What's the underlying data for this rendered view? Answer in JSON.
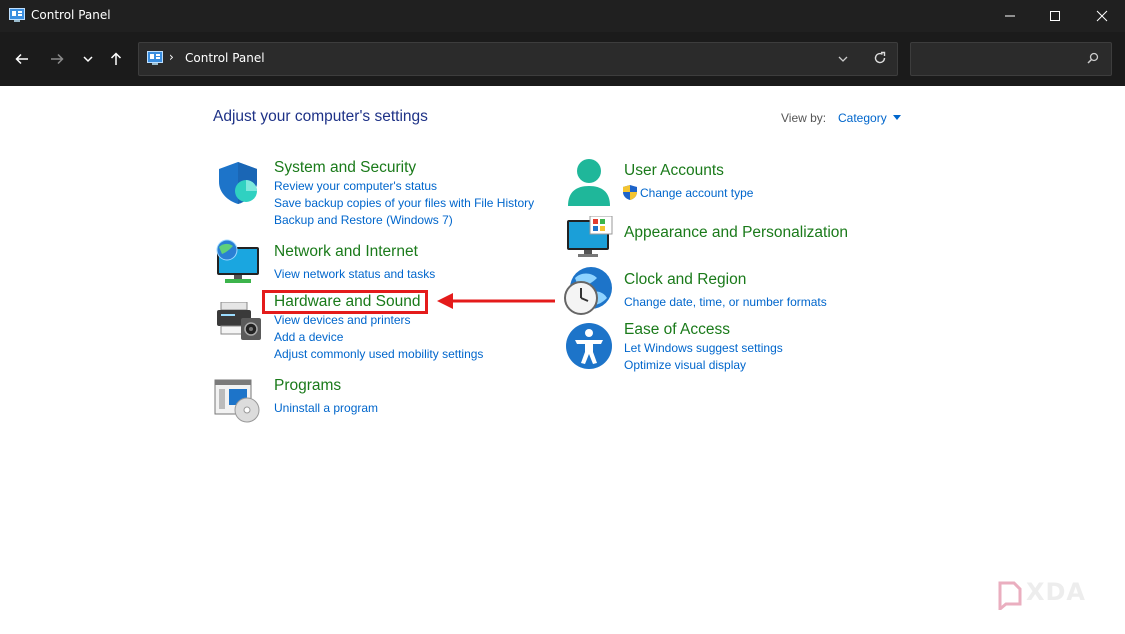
{
  "window": {
    "title": "Control Panel"
  },
  "address": {
    "path": "Control Panel",
    "separator": "›"
  },
  "search": {
    "placeholder": ""
  },
  "main": {
    "heading": "Adjust your computer's settings",
    "view_by_label": "View by:",
    "view_by_value": "Category"
  },
  "categories": {
    "system_security": {
      "title": "System and Security",
      "links": [
        "Review your computer's status",
        "Save backup copies of your files with File History",
        "Backup and Restore (Windows 7)"
      ]
    },
    "network_internet": {
      "title": "Network and Internet",
      "links": [
        "View network status and tasks"
      ]
    },
    "hardware_sound": {
      "title": "Hardware and Sound",
      "links": [
        "View devices and printers",
        "Add a device",
        "Adjust commonly used mobility settings"
      ]
    },
    "programs": {
      "title": "Programs",
      "links": [
        "Uninstall a program"
      ]
    },
    "user_accounts": {
      "title": "User Accounts",
      "links": [
        "Change account type"
      ]
    },
    "appearance": {
      "title": "Appearance and Personalization",
      "links": []
    },
    "clock_region": {
      "title": "Clock and Region",
      "links": [
        "Change date, time, or number formats"
      ]
    },
    "ease_access": {
      "title": "Ease of Access",
      "links": [
        "Let Windows suggest settings",
        "Optimize visual display"
      ]
    }
  },
  "watermark": {
    "text": "XDA"
  },
  "colors": {
    "title_bar": "#202020",
    "link": "#0066cc",
    "category": "#1a7a1a",
    "heading": "#1e3287",
    "annotation": "#e41b1b"
  },
  "icons": [
    "control-panel-icon",
    "back-icon",
    "forward-icon",
    "recent-icon",
    "up-icon",
    "refresh-icon",
    "search-icon",
    "minimize-icon",
    "maximize-icon",
    "close-icon",
    "shield-icon",
    "network-icon",
    "printer-icon",
    "programs-icon",
    "user-icon",
    "uac-shield-icon",
    "monitor-icon",
    "clock-globe-icon",
    "accessibility-icon"
  ]
}
